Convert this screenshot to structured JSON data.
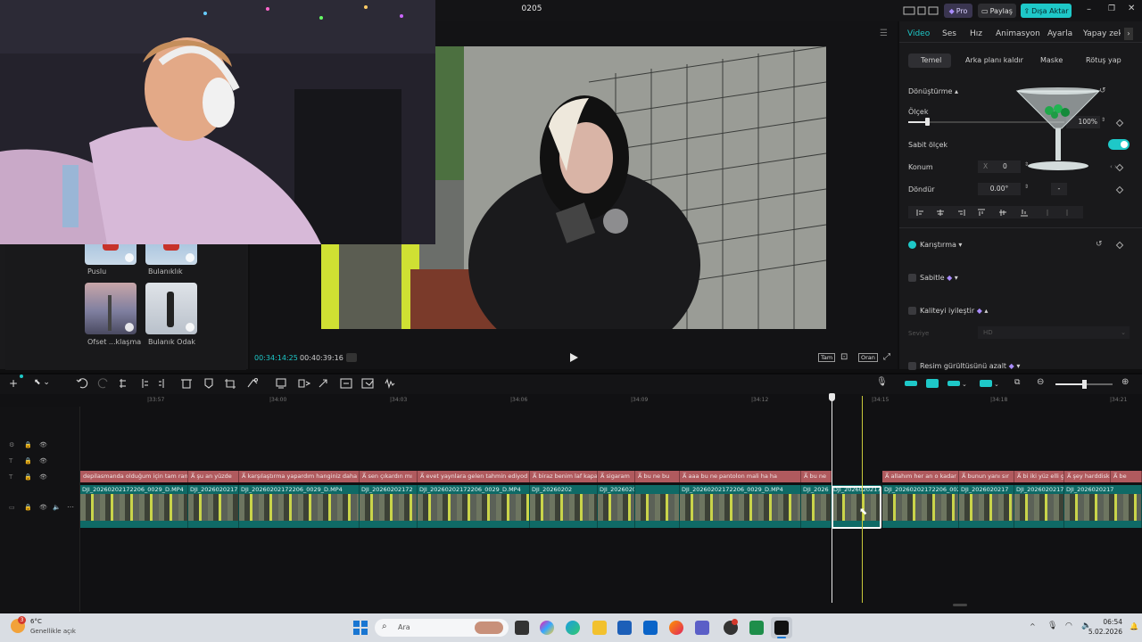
{
  "app": {
    "project_title": "0205",
    "pro_label": "Pro",
    "share_label": "Paylaş",
    "export_label": "Dışa Aktar"
  },
  "media": {
    "items": [
      {
        "label": "Puslu"
      },
      {
        "label": "Bulanıklık"
      },
      {
        "label": "Ofset ...klaşma"
      },
      {
        "label": "Bulanık Odak"
      }
    ]
  },
  "player": {
    "current_time": "00:34:14:25",
    "total_time": "00:40:39:16",
    "full_label": "Tam",
    "ratio_label": "Oran"
  },
  "inspector": {
    "tabs": [
      "Video",
      "Ses",
      "Hız",
      "Animasyon",
      "Ayarla",
      "Yapay zekâ"
    ],
    "subtabs": [
      "Temel",
      "Arka planı kaldır",
      "Maske",
      "Rötuş yap"
    ],
    "transform_label": "Dönüştürme",
    "scale_label": "Ölçek",
    "scale_value": "100%",
    "uniform_scale_label": "Sabit ölçek",
    "position_label": "Konum",
    "position_x_label": "X",
    "position_x_value": "0",
    "rotate_label": "Döndür",
    "rotate_value": "0.00°",
    "rotate_flip_label": "-",
    "blend_label": "Karıştırma",
    "stabilize_label": "Sabitle",
    "enhance_label": "Kaliteyi iyileştir",
    "level_label": "Seviye",
    "level_value": "HD",
    "denoise_label": "Resim gürültüsünü azalt",
    "scale_slider_fraction": 0.12
  },
  "timeline": {
    "ruler": [
      "|33:57",
      "|34:00",
      "|34:03",
      "|34:06",
      "|34:09",
      "|34:12",
      "|34:15",
      "|34:18",
      "|34:21"
    ],
    "subtitles": [
      "depilasmanda olduğum için tam rando",
      "şu an yüzde",
      "karşılaştırma yapardım hanginiz daha eğ",
      "sen çıkardın mı",
      "evet yaynlara gelen tahmin ediyod",
      "biraz benim laf kapa",
      "sigaram",
      "bu ne bu",
      "aaa bu ne pantolon mali ha ha",
      "bu ne",
      "allahım her an o kadar k",
      "bunun yanı sır",
      "bi iki yüz elli g",
      "şey harddisk",
      "be"
    ],
    "clips": [
      "DJI_20260202172206_0029_D.MP4",
      "DJI_20260202172",
      "DJI_20260202172206_0029_D.MP4",
      "DJI_20260202172",
      "DJI_20260202172206_0029_D.MP4",
      "DJI_20260202",
      "DJI_20260202",
      "DJI_20260202172206_0029_D.MP4",
      "DJI_2026",
      "DJI_2026020217",
      "DJI_20260202172206_0029",
      "DJI_2026020217",
      "DJI_2026020217",
      "DJI_2026020217"
    ]
  },
  "taskbar": {
    "weather_temp": "6°C",
    "weather_desc": "Genellikle açık",
    "weather_badge": "3",
    "search_placeholder": "Ara",
    "time": "06:54",
    "date": "5.02.2026"
  },
  "colors": {
    "accent": "#1ec8c8",
    "subtitle_clip": "#b05a5e",
    "video_clip": "#0f6a66",
    "playhead": "#ffffff",
    "marker": "#c9c93a"
  }
}
